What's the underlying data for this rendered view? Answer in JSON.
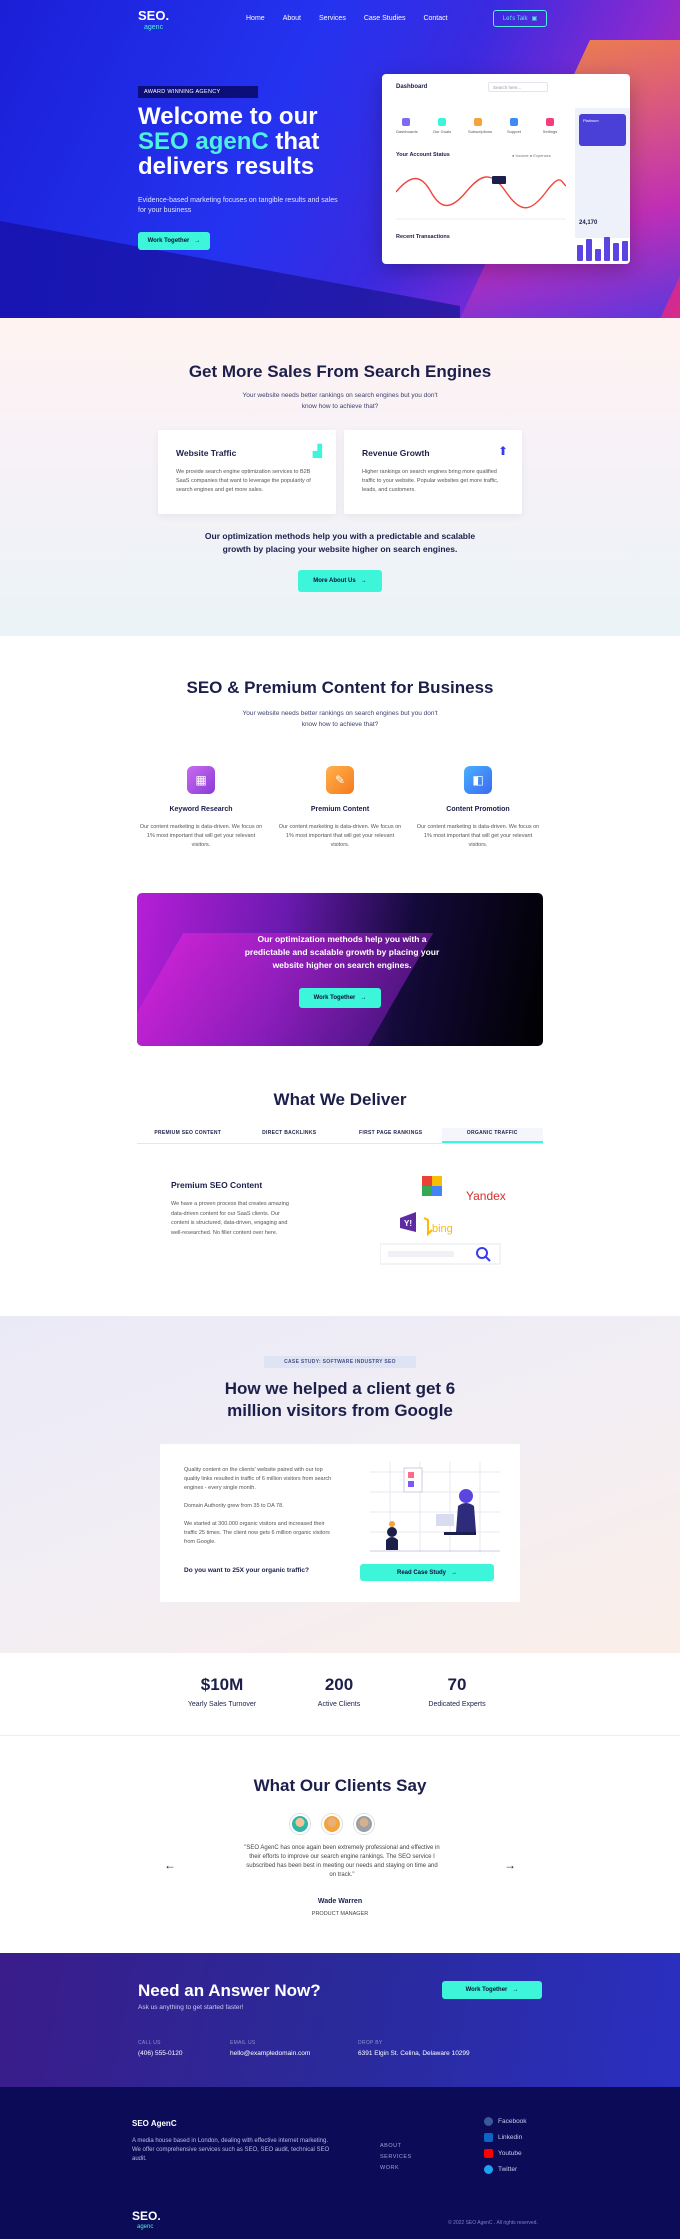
{
  "brand": {
    "logo": "SEO.",
    "logo_sub": "agenc"
  },
  "nav": {
    "links": [
      "Home",
      "About",
      "Services",
      "Case Studies",
      "Contact"
    ],
    "cta": "Let's Talk"
  },
  "hero": {
    "badge": "AWARD WINNING AGENCY",
    "title_line1": "Welcome to our",
    "title_accent": "SEO agenC",
    "title_tail": "that",
    "title_line3": "delivers results",
    "subtitle": "Evidence-based marketing focuses on tangible results and sales for your business",
    "button": "Work Together"
  },
  "dashboard": {
    "title": "Dashboard",
    "search_placeholder": "Search here...",
    "shortcuts": [
      "Dashboards",
      "Our Goals",
      "Subscriptions",
      "Support",
      "Settings"
    ],
    "account_status": "Your Account Status",
    "legend": [
      "Income",
      "Expenses"
    ],
    "transactions": "Recent Transactions",
    "card_label": "Platinum",
    "balance": "24,170"
  },
  "sales": {
    "title": "Get More Sales From Search Engines",
    "subtitle": "Your website needs better rankings on search engines but you don't know how to achieve that?",
    "cards": [
      {
        "title": "Website Traffic",
        "text": "We provide search engine optimization services to B2B SaaS companies that want to leverage the popularity of search engines and get more sales."
      },
      {
        "title": "Revenue Growth",
        "text": "Higher rankings on search engines bring more qualified traffic to your website. Popular websites get more traffic, leads, and customers."
      }
    ],
    "quote": "Our optimization methods help you with a predictable and scalable growth by placing your website higher on search engines.",
    "button": "More About Us"
  },
  "content": {
    "title": "SEO & Premium Content for Business",
    "subtitle": "Your website needs better rankings on search engines but you don't know how to achieve that?",
    "features": [
      {
        "title": "Keyword Research",
        "text": "Our content marketing is data-driven. We focus on 1% most important that will get your relevant visitors."
      },
      {
        "title": "Premium Content",
        "text": "Our content marketing is data-driven. We focus on 1% most important that will get your relevant visitors."
      },
      {
        "title": "Content Promotion",
        "text": "Our content marketing is data-driven. We focus on 1% most important that will get your relevant visitors."
      }
    ],
    "promo": "Our optimization methods help you with a predictable and scalable growth by placing your website higher on search engines.",
    "promo_button": "Work Together"
  },
  "deliver": {
    "title": "What We Deliver",
    "tabs": [
      "PREMIUM SEO CONTENT",
      "DIRECT BACKLINKS",
      "FIRST PAGE RANKINGS",
      "ORGANIC TRAFFIC"
    ],
    "panel_title": "Premium SEO Content",
    "panel_text": "We have a proven process that creates amazing data-driven content for our SaaS clients. Our content is structured, data-driven, engaging and well-researched. No filler content over here.",
    "engines": [
      "Yandex",
      "bing"
    ]
  },
  "case": {
    "tag": "CASE STUDY: SOFTWARE INDUSTRY SEO",
    "title": "How we helped a client get 6 million visitors from Google",
    "p1": "Quality content on the clients' website paired with our top quality links resulted in traffic of 6 million visitors from search engines - every single month.",
    "p2": "Domain Authority grew from 35 to DA 78.",
    "p3": "We started at 300.000 organic visitors and increased their traffic 25 times. The client now gets 6 million organic visitors from Google.",
    "question": "Do you want to 25X your organic traffic?",
    "button": "Read Case Study"
  },
  "stats": [
    {
      "value": "$10M",
      "label": "Yearly Sales Turnover"
    },
    {
      "value": "200",
      "label": "Active Clients"
    },
    {
      "value": "70",
      "label": "Dedicated Experts"
    }
  ],
  "testimonials": {
    "title": "What Our Clients Say",
    "quote": "\"SEO AgenC has once again been extremely professional and effective in their efforts to improve our search engine rankings. The SEO service I subscribed has been best in meeting our needs and staying on time and on track.\"",
    "name": "Wade Warren",
    "role": "PRODUCT MANAGER"
  },
  "cta": {
    "title": "Need an Answer Now?",
    "subtitle": "Ask us anything to get started faster!",
    "button": "Work Together",
    "contacts": [
      {
        "label": "CALL US",
        "value": "(406) 555-0120"
      },
      {
        "label": "EMAIL US",
        "value": "hello@exampledomain.com"
      },
      {
        "label": "DROP BY",
        "value": "6391 Elgin St. Celina, Delaware 10299"
      }
    ]
  },
  "footer": {
    "title": "SEO AgenC",
    "text": "A media house based in London, dealing with effective internet marketing. We offer comprehensive services such as SEO, SEO audit, technical SEO audit.",
    "links": [
      "ABOUT",
      "SERVICES",
      "WORK"
    ],
    "social": [
      "Facebook",
      "Linkedin",
      "Youtube",
      "Twitter"
    ],
    "copyright": "© 2022 SEO AgenC . All rights reserved."
  },
  "colors": {
    "accent": "#3df5d9",
    "navy": "#1b1f4a",
    "hero": "#2433f0",
    "footer": "#0b0b58"
  }
}
